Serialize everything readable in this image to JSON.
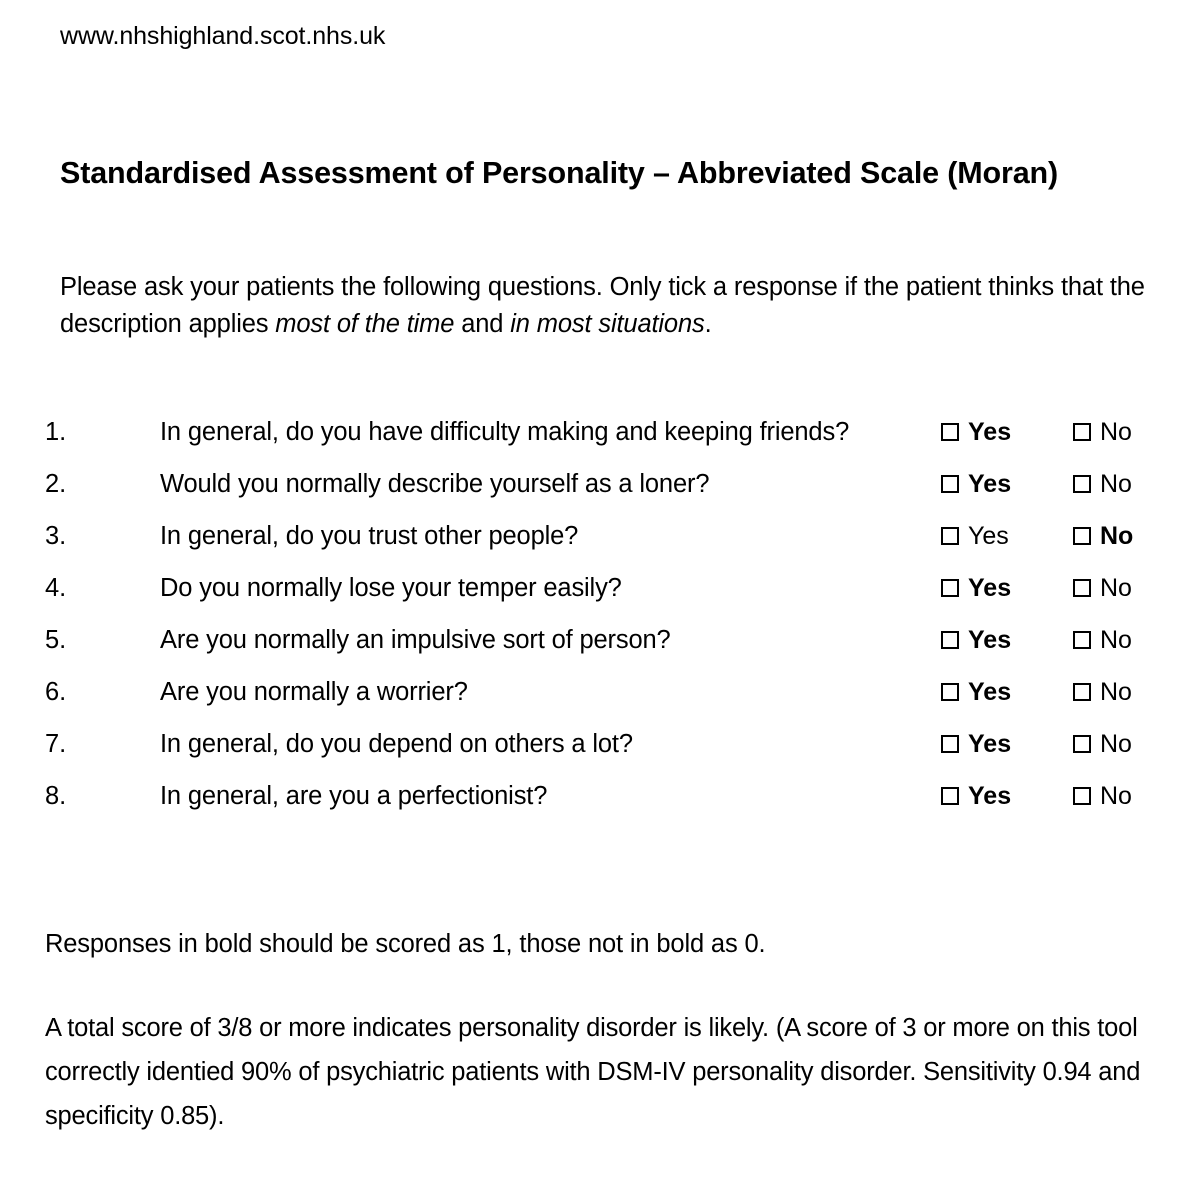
{
  "header": {
    "site_url": "www.nhshighland.scot.nhs.uk"
  },
  "document": {
    "title": "Standardised Assessment of Personality – Abbreviated Scale (Moran)",
    "intro": {
      "part1": "Please ask your patients the following questions. Only tick a response if the patient thinks that the description applies ",
      "italic1": "most of the time",
      "part2": " and ",
      "italic2": "in most situations",
      "part3": "."
    }
  },
  "questions": [
    {
      "number": "1.",
      "text": "In general, do you have difficulty making and keeping friends?",
      "yes_label": "Yes",
      "no_label": "No",
      "yes_bold": true,
      "no_bold": false
    },
    {
      "number": "2.",
      "text": "Would you normally describe yourself as a loner?",
      "yes_label": "Yes",
      "no_label": "No",
      "yes_bold": true,
      "no_bold": false
    },
    {
      "number": "3.",
      "text": "In general, do you trust other people?",
      "yes_label": "Yes",
      "no_label": "No",
      "yes_bold": false,
      "no_bold": true
    },
    {
      "number": "4.",
      "text": "Do you normally lose your temper easily?",
      "yes_label": "Yes",
      "no_label": "No",
      "yes_bold": true,
      "no_bold": false
    },
    {
      "number": "5.",
      "text": "Are you normally an impulsive sort of person?",
      "yes_label": "Yes",
      "no_label": "No",
      "yes_bold": true,
      "no_bold": false
    },
    {
      "number": "6.",
      "text": "Are you normally a worrier?",
      "yes_label": "Yes",
      "no_label": "No",
      "yes_bold": true,
      "no_bold": false
    },
    {
      "number": "7.",
      "text": "In general, do you depend on others a lot?",
      "yes_label": "Yes",
      "no_label": "No",
      "yes_bold": true,
      "no_bold": false
    },
    {
      "number": "8.",
      "text": "In general, are you a perfectionist?",
      "yes_label": "Yes",
      "no_label": "No",
      "yes_bold": true,
      "no_bold": false
    }
  ],
  "notes": {
    "scoring": "Responses in bold should be scored as 1, those not in bold as 0.",
    "interpretation": "A total score of 3/8 or more indicates personality disorder is likely. (A score of 3 or more on this tool correctly identied 90% of psychiatric patients with DSM-IV personality disorder. Sensitivity 0.94 and specificity 0.85)."
  },
  "colors": {
    "text": "#000000",
    "page_background": "#ffffff",
    "checkbox_border": "#000000"
  }
}
